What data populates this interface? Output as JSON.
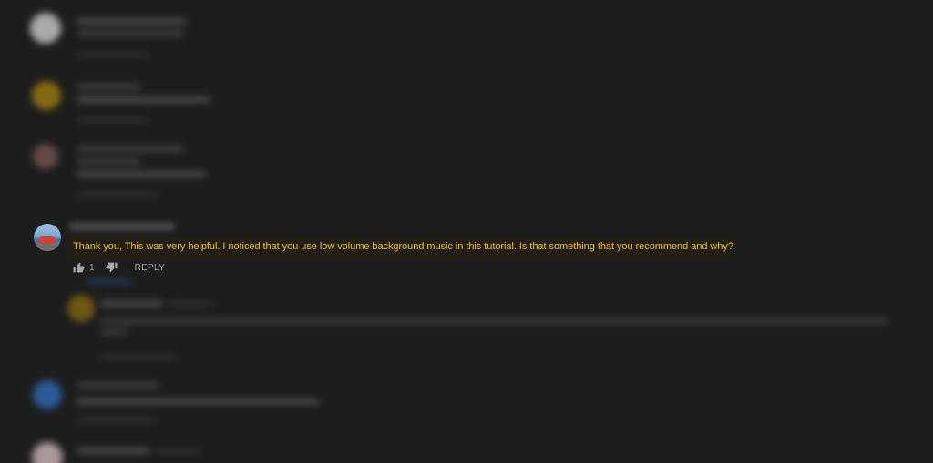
{
  "comment": {
    "text": "Thank you, This was very helpful. I noticed that you use low volume background music in this tutorial. Is that something that you recommend and why?",
    "like_count": "1",
    "reply_label": "REPLY"
  },
  "icons": {
    "like": "thumbs-up-icon",
    "dislike": "thumbs-down-icon"
  },
  "colors": {
    "background": "#1d1d1d",
    "comment_text": "#f0c020",
    "highlight": "#221e14",
    "secondary_text": "#aaaaaa"
  }
}
